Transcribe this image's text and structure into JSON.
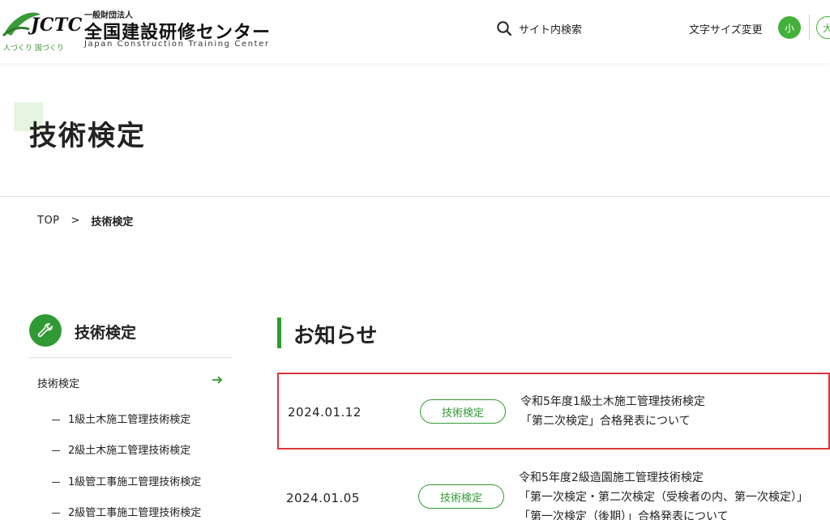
{
  "header": {
    "logo_mark": "JCTC",
    "logo_tag": "人づくり 国づくり",
    "org_small": "一般財団法人",
    "org_name": "全国建設研修センター",
    "org_name_en": "Japan Construction Training Center",
    "search_label": "サイト内検索",
    "font_size_label": "文字サイズ変更",
    "font_small": "小",
    "font_large": "大"
  },
  "page": {
    "title": "技術検定"
  },
  "breadcrumb": {
    "top": "TOP",
    "separator": ">",
    "current": "技術検定"
  },
  "sidebar": {
    "title": "技術検定",
    "main_item": "技術検定",
    "sub_items": [
      "1級土木施工管理技術検定",
      "2級土木施工管理技術検定",
      "1級管工事施工管理技術検定",
      "2級管工事施工管理技術検定"
    ]
  },
  "news": {
    "heading": "お知らせ",
    "items": [
      {
        "date": "2024.01.12",
        "tag": "技術検定",
        "line1": "令和5年度1級土木施工管理技術検定",
        "line2": "「第二次検定」合格発表について",
        "line3": ""
      },
      {
        "date": "2024.01.05",
        "tag": "技術検定",
        "line1": "令和5年度2級造園施工管理技術検定",
        "line2": "「第一次検定・第二次検定（受検者の内、第一次検定）」",
        "line3": "「第一次検定（後期）」合格発表について"
      }
    ]
  },
  "colors": {
    "brand_green": "#2f9a34",
    "accent_green": "#42b03a",
    "highlight_red": "#d9363e"
  }
}
